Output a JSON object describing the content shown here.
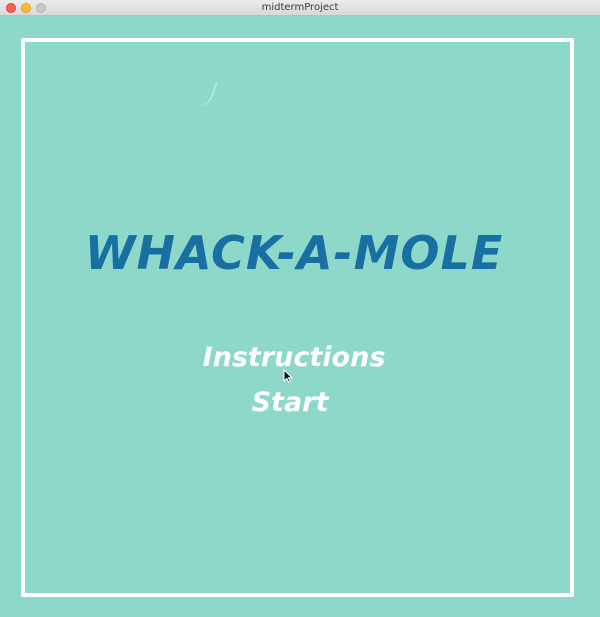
{
  "window": {
    "title": "midtermProject"
  },
  "game": {
    "title": "WHACK-A-MOLE",
    "menu": {
      "instructions_label": "Instructions",
      "start_label": "Start"
    }
  },
  "colors": {
    "background": "#8ed8ca",
    "title_text": "#1870a2",
    "menu_text": "#ffffff",
    "frame": "#ffffff"
  },
  "icons": {
    "cursor": "arrow-cursor-icon"
  }
}
